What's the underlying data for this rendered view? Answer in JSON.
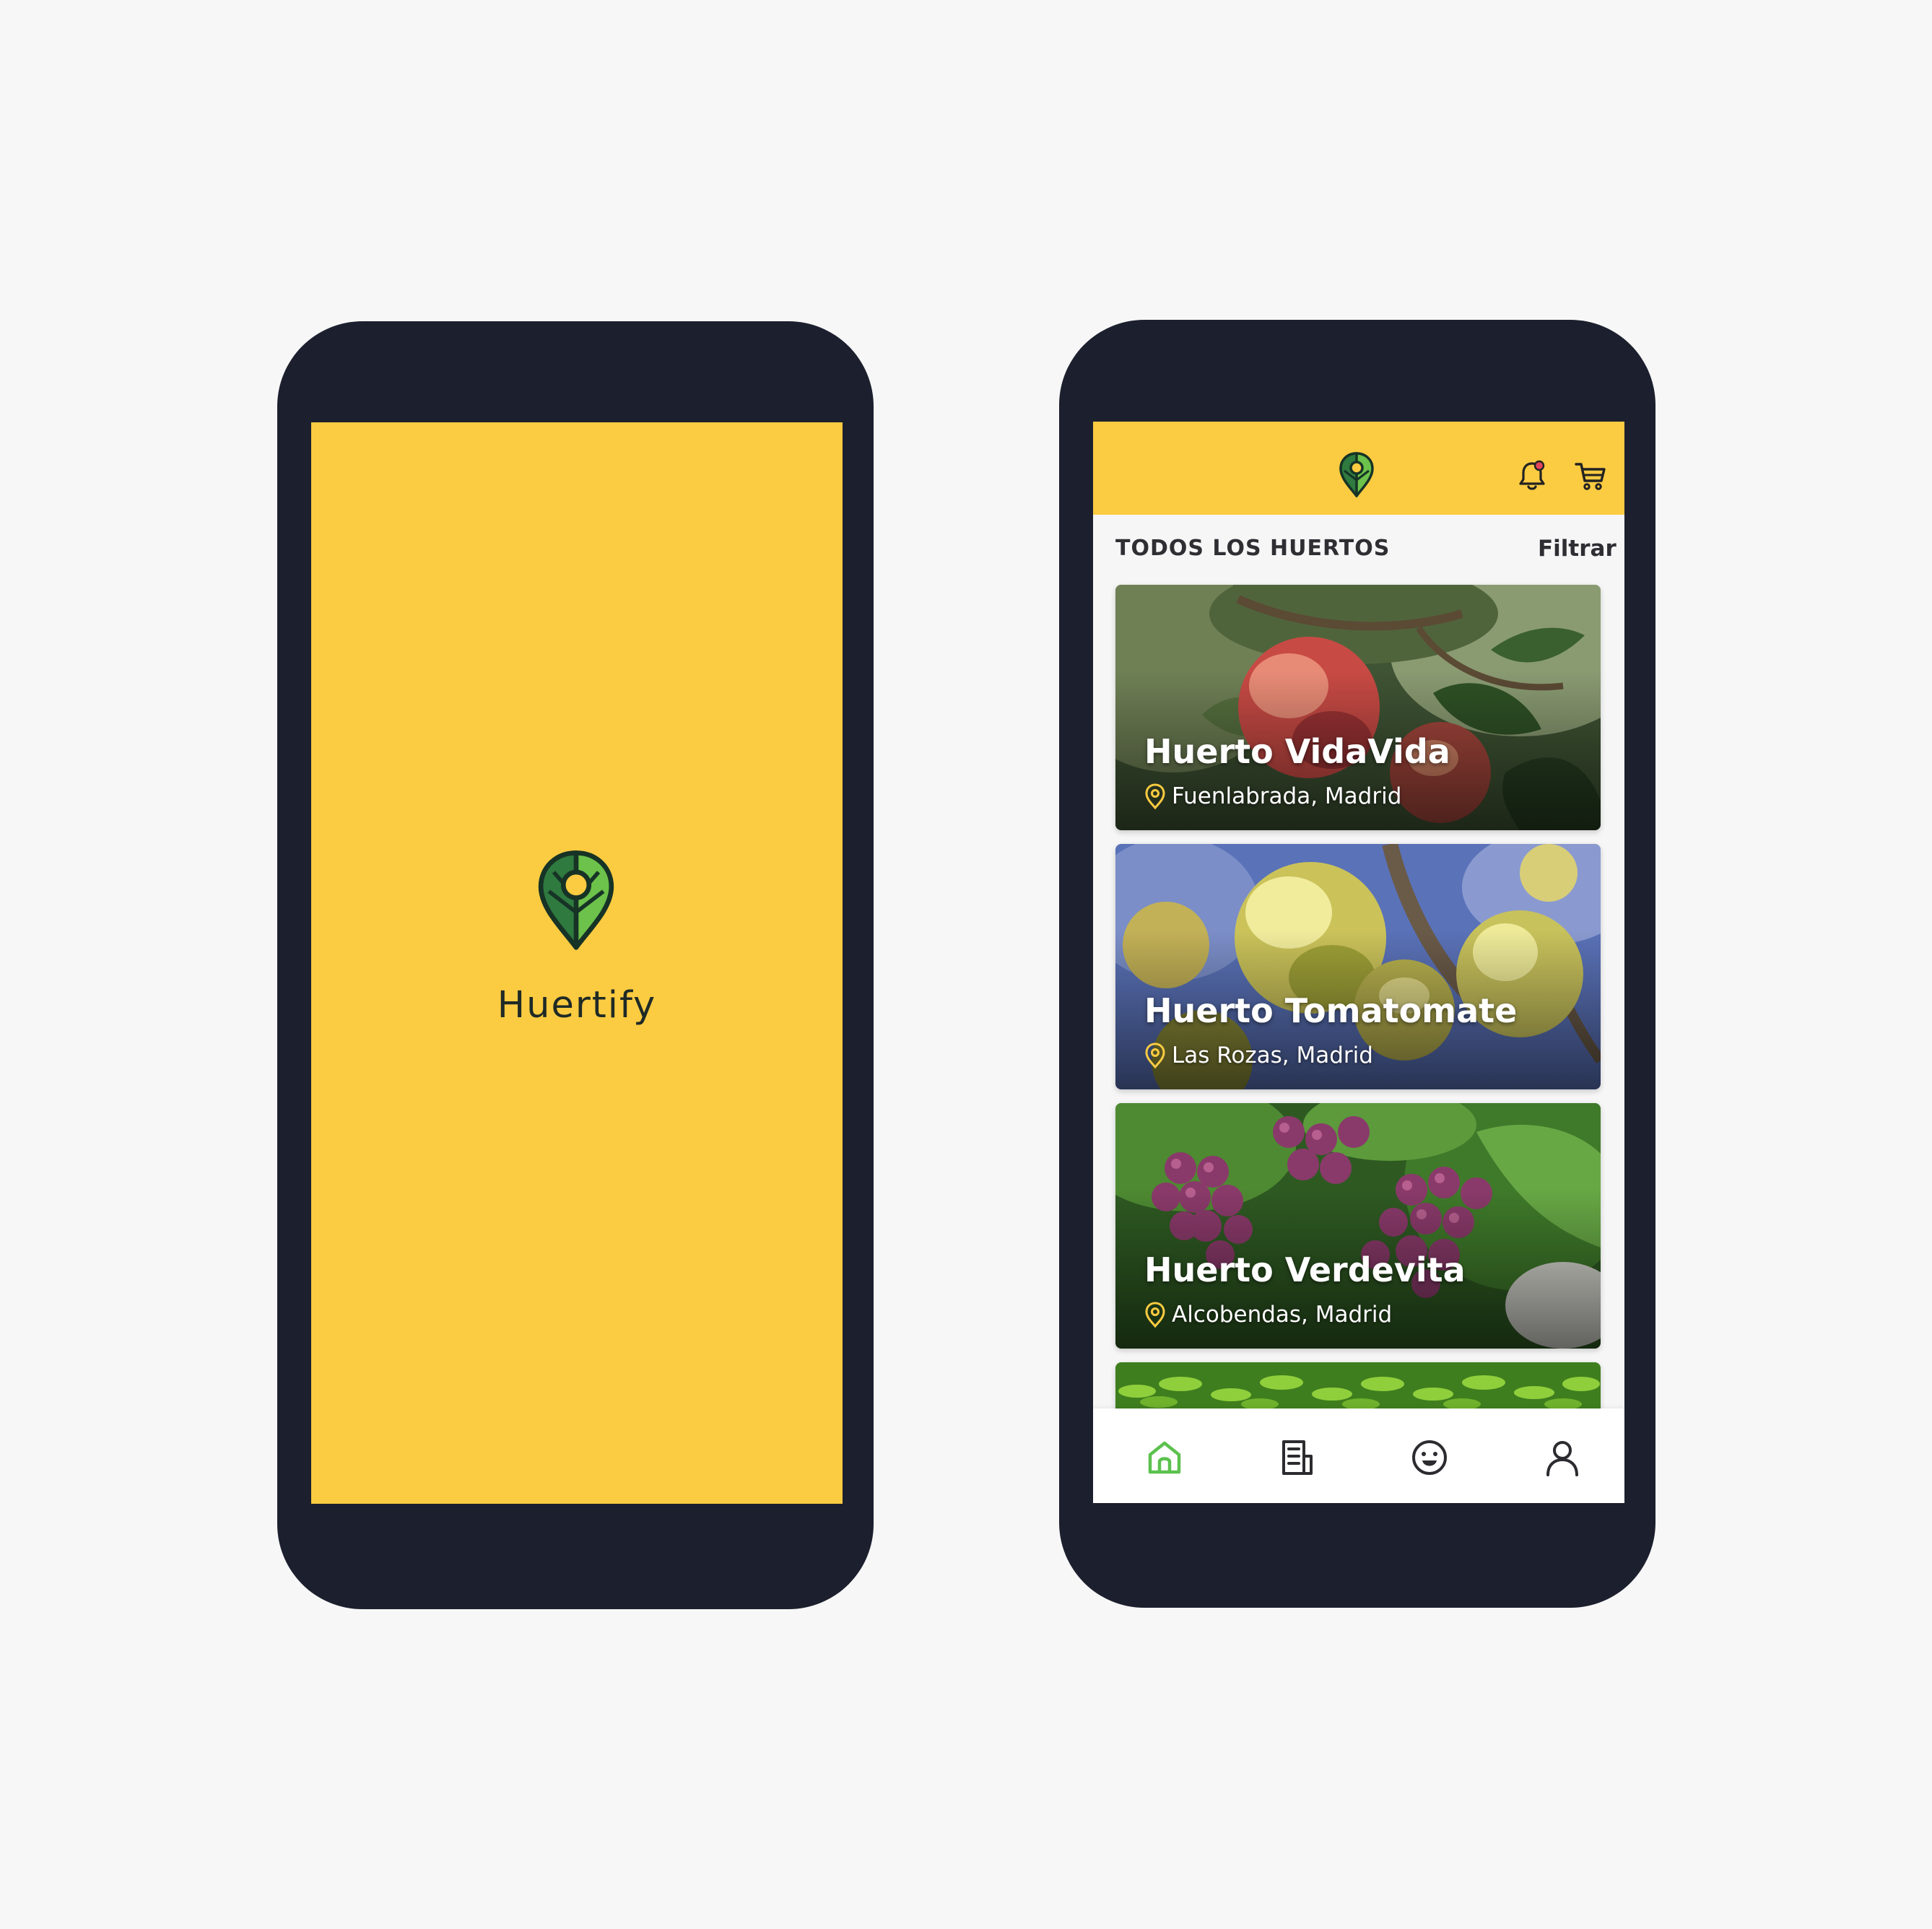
{
  "colors": {
    "background": "#f7f7f7",
    "phone_frame": "#1c1f2e",
    "brand_yellow": "#fbcb41",
    "brand_green_dark": "#2f7a3f",
    "brand_green_light": "#6cc24a",
    "active_nav": "#5cc14e",
    "text_dark": "#2e2e33"
  },
  "splash": {
    "logo_icon": "map-pin-leaf-icon",
    "app_name": "Huertify"
  },
  "app": {
    "header": {
      "logo_icon": "map-pin-leaf-icon",
      "notifications_icon": "bell-icon",
      "cart_icon": "shopping-cart-icon"
    },
    "section": {
      "title": "TODOS LOS HUERTOS",
      "filter_label": "Filtrar",
      "filter_icon": "chevron-right-icon"
    },
    "gardens": [
      {
        "name": "Huerto VidaVida",
        "location": "Fuenlabrada, Madrid",
        "image": "red apples on tree"
      },
      {
        "name": "Huerto Tomatomate",
        "location": "Las Rozas, Madrid",
        "image": "yellow apples on branch"
      },
      {
        "name": "Huerto Verdevita",
        "location": "Alcobendas, Madrid",
        "image": "purple grapes with leaves"
      },
      {
        "name": "",
        "location": "",
        "image": "green peppers"
      }
    ],
    "nav": [
      {
        "icon": "home-icon",
        "active": true
      },
      {
        "icon": "receipt-icon",
        "active": false
      },
      {
        "icon": "smiley-icon",
        "active": false
      },
      {
        "icon": "user-icon",
        "active": false
      }
    ]
  }
}
